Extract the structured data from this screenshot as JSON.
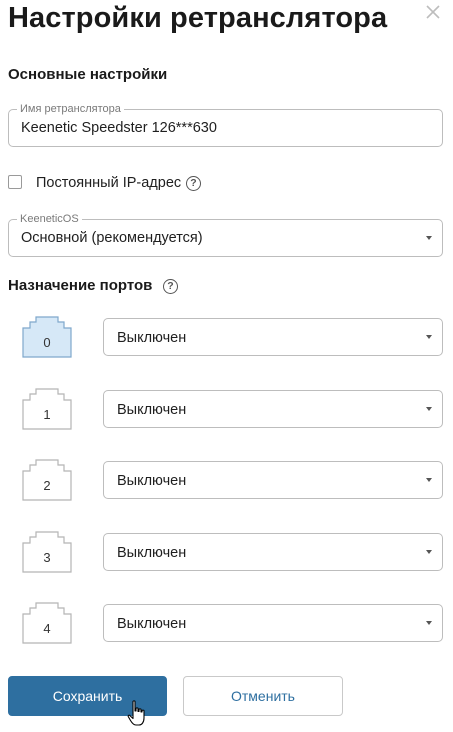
{
  "dialog": {
    "title": "Настройки ретранслятора"
  },
  "icons": {
    "close": "close-icon",
    "help": "help-icon",
    "port": "ethernet-port-icon",
    "cursor": "hand-pointer-icon"
  },
  "basic": {
    "section_title": "Основные настройки",
    "name_field": {
      "label": "Имя ретранслятора",
      "value": "Keenetic Speedster 126***630"
    },
    "static_ip": {
      "label": "Постоянный IP-адрес",
      "checked": false
    },
    "os_field": {
      "label": "KeeneticOS",
      "value": "Основной (рекомендуется)"
    }
  },
  "ports": {
    "section_title": "Назначение портов",
    "items": [
      {
        "number": "0",
        "value": "Выключен",
        "active": true
      },
      {
        "number": "1",
        "value": "Выключен",
        "active": false
      },
      {
        "number": "2",
        "value": "Выключен",
        "active": false
      },
      {
        "number": "3",
        "value": "Выключен",
        "active": false
      },
      {
        "number": "4",
        "value": "Выключен",
        "active": false
      }
    ]
  },
  "actions": {
    "save": "Сохранить",
    "cancel": "Отменить"
  },
  "colors": {
    "primary": "#2e6fa0",
    "port_active_fill": "#d6e8f7",
    "port_active_stroke": "#7fa8cc"
  }
}
